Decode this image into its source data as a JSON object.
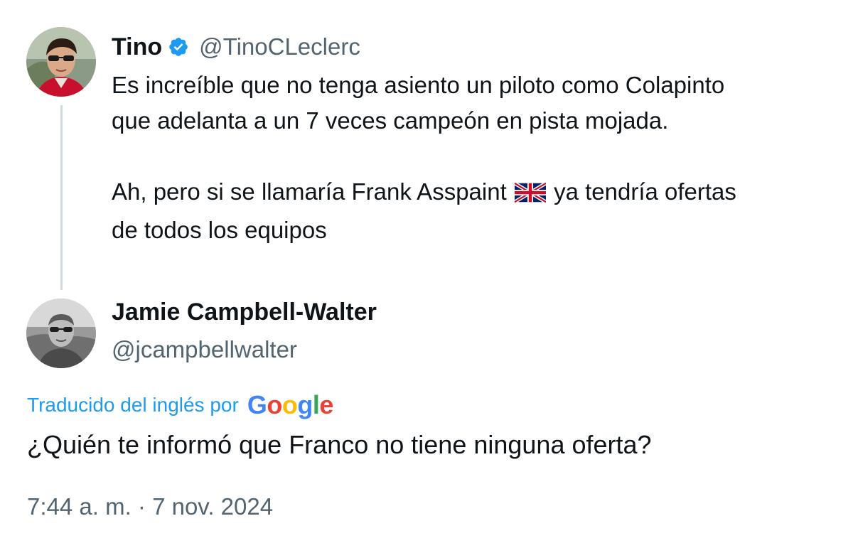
{
  "original_tweet": {
    "author_name": "Tino",
    "author_handle": "@TinoCLeclerc",
    "verified": true,
    "avatar": "profile-photo-driver-red-shirt-sunglasses",
    "text_lines": [
      "Es increíble que no tenga asiento un piloto como Colapinto",
      "que adelanta a un 7 veces campeón en pista mojada."
    ],
    "text2_before_flag": "Ah, pero si se llamaría Frank Asspaint ",
    "flag_icon": "uk-flag-icon",
    "text2_after_flag": " ya tendría ofertas",
    "text2_line2": "de todos los equipos"
  },
  "reply": {
    "author_name": "Jamie Campbell-Walter",
    "author_handle": "@jcampbellwalter",
    "avatar": "profile-photo-grayscale-man-sunglasses",
    "translated_label": "Traducido del inglés por",
    "translator_logo": [
      "G",
      "o",
      "o",
      "g",
      "l",
      "e"
    ],
    "text": "¿Quién te informó que Franco no tiene ninguna oferta?",
    "timestamp": "7:44 a. m. · 7 nov. 2024"
  },
  "colors": {
    "text_primary": "#0f1419",
    "text_secondary": "#536471",
    "accent_blue": "#1d9bf0",
    "thread_line": "#cfd9de",
    "verified_badge": "#1d9bf0"
  }
}
